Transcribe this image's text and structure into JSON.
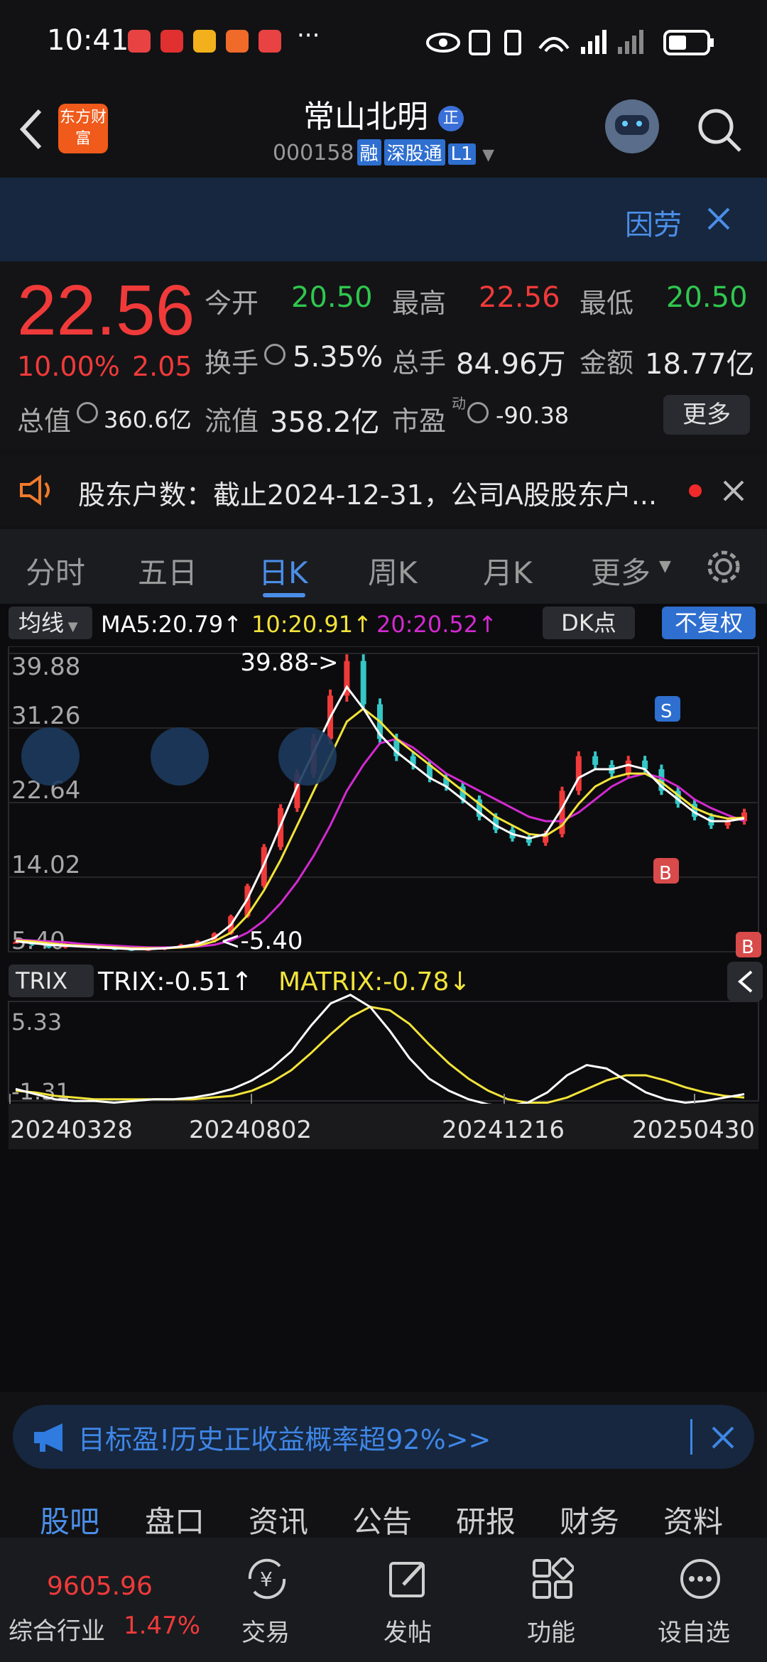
{
  "status": {
    "time": "10:41",
    "network": "5G"
  },
  "header": {
    "title": "常山北明",
    "title_badge": "正",
    "code": "000158",
    "tags": [
      "融",
      "深股通",
      "L1"
    ],
    "logo_text": "东方财富"
  },
  "banner": {
    "text": "因劳"
  },
  "quote": {
    "price": "22.56",
    "change_pct": "10.00%",
    "change_abs": "2.05",
    "open_label": "今开",
    "open": "20.50",
    "high_label": "最高",
    "high": "22.56",
    "low_label": "最低",
    "low": "20.50",
    "turnover_label": "换手",
    "turnover": "5.35%",
    "volume_label": "总手",
    "volume": "84.96万",
    "amount_label": "金额",
    "amount": "18.77亿",
    "mktcap_label": "总值",
    "mktcap": "360.6亿",
    "float_label": "流值",
    "float": "358.2亿",
    "pe_label": "市盈",
    "pe_sup": "动",
    "pe": "-90.38",
    "more": "更多"
  },
  "notice": {
    "text": "股东户数：截止2024-12-31，公司A股股东户..."
  },
  "tabs": [
    "分时",
    "五日",
    "日K",
    "周K",
    "月K",
    "更多"
  ],
  "active_tab": "日K",
  "chart_header": {
    "ma_btn": "均线",
    "ma5": "MA5:20.79↑",
    "ma10": "10:20.91↑",
    "ma20": "20:20.52↑",
    "dk": "DK点",
    "fq": "不复权"
  },
  "indicator_header": {
    "name": "TRIX",
    "trix": "TRIX:-0.51↑",
    "matrix": "MATRIX:-0.78↓"
  },
  "chart_data": {
    "type": "line",
    "y_ticks": [
      "39.88",
      "31.26",
      "22.64",
      "14.02",
      "5.40"
    ],
    "ylim": [
      5.4,
      39.88
    ],
    "max_label": "39.88->",
    "min_label": "<-5.40",
    "marks": [
      "S",
      "B",
      "B"
    ],
    "trix_ticks": [
      "5.33",
      "-1.31"
    ],
    "trix_ylim": [
      -1.31,
      5.33
    ],
    "x_ticks": [
      "20240328",
      "20240802",
      "20241216",
      "20250430"
    ],
    "colors": {
      "ma5": "#ffffff",
      "ma10": "#f2e33a",
      "ma20": "#d22ad0",
      "up": "#f03a3a",
      "down": "#35c6c6",
      "trix": "#ffffff",
      "matrix": "#f2e33a"
    },
    "price_close": [
      6.5,
      6.2,
      5.9,
      6.3,
      6.0,
      5.8,
      5.7,
      5.6,
      5.7,
      5.9,
      6.2,
      6.6,
      7.5,
      9.5,
      13.0,
      17.5,
      22.0,
      26.0,
      30.0,
      35.0,
      39.0,
      34.0,
      30.0,
      28.0,
      27.0,
      25.5,
      24.5,
      23.0,
      21.0,
      19.5,
      18.5,
      18.0,
      19.0,
      24.0,
      28.0,
      27.0,
      26.0,
      27.5,
      26.5,
      24.0,
      22.5,
      21.0,
      20.0,
      20.5,
      21.5
    ],
    "ma5": [
      6.6,
      6.4,
      6.2,
      6.1,
      6.0,
      5.9,
      5.8,
      5.7,
      5.7,
      5.8,
      6.0,
      6.3,
      7.0,
      8.5,
      11.5,
      15.5,
      20.0,
      24.5,
      28.5,
      32.5,
      36.0,
      33.5,
      30.5,
      28.5,
      27.0,
      25.5,
      24.5,
      23.0,
      21.5,
      20.0,
      19.0,
      18.5,
      19.0,
      22.0,
      25.5,
      26.5,
      26.5,
      27.0,
      26.5,
      24.5,
      23.0,
      21.5,
      20.5,
      20.5,
      20.8
    ],
    "ma10": [
      6.7,
      6.6,
      6.4,
      6.2,
      6.1,
      6.0,
      5.9,
      5.8,
      5.8,
      5.8,
      5.9,
      6.1,
      6.6,
      7.6,
      9.6,
      12.5,
      16.0,
      20.0,
      24.0,
      28.0,
      32.0,
      33.5,
      32.0,
      30.0,
      28.5,
      27.0,
      25.5,
      24.0,
      22.5,
      21.0,
      20.0,
      19.0,
      18.8,
      20.0,
      22.5,
      24.5,
      25.5,
      26.0,
      26.0,
      25.0,
      23.5,
      22.0,
      21.2,
      20.8,
      20.9
    ],
    "ma20": [
      6.8,
      6.7,
      6.6,
      6.5,
      6.3,
      6.2,
      6.1,
      6.0,
      5.9,
      5.9,
      5.9,
      6.0,
      6.2,
      6.7,
      7.6,
      9.0,
      11.0,
      13.5,
      16.5,
      20.0,
      24.0,
      27.0,
      29.5,
      30.0,
      29.0,
      27.5,
      26.0,
      25.0,
      24.0,
      23.0,
      22.0,
      21.0,
      20.5,
      20.5,
      21.5,
      23.0,
      24.5,
      25.5,
      26.0,
      25.5,
      24.5,
      23.0,
      22.0,
      21.2,
      20.5
    ],
    "trix": [
      -0.2,
      -0.5,
      -0.8,
      -0.9,
      -0.9,
      -1.0,
      -0.9,
      -0.8,
      -0.8,
      -0.7,
      -0.5,
      -0.2,
      0.3,
      1.0,
      2.0,
      3.5,
      4.8,
      5.3,
      4.6,
      3.2,
      1.6,
      0.4,
      -0.3,
      -0.8,
      -1.1,
      -1.2,
      -1.0,
      -0.4,
      0.6,
      1.2,
      1.0,
      0.3,
      -0.4,
      -0.8,
      -1.0,
      -0.9,
      -0.7,
      -0.5
    ],
    "matrix": [
      -0.3,
      -0.4,
      -0.6,
      -0.7,
      -0.8,
      -0.8,
      -0.8,
      -0.8,
      -0.8,
      -0.8,
      -0.7,
      -0.6,
      -0.3,
      0.2,
      0.9,
      1.9,
      3.0,
      4.0,
      4.6,
      4.4,
      3.6,
      2.4,
      1.3,
      0.4,
      -0.3,
      -0.8,
      -1.0,
      -1.0,
      -0.7,
      -0.2,
      0.3,
      0.6,
      0.6,
      0.3,
      -0.1,
      -0.4,
      -0.6,
      -0.7
    ]
  },
  "ad": {
    "text": "目标盈!历史正收益概率超92%>>"
  },
  "subnav": [
    "股吧",
    "盘口",
    "资讯",
    "公告",
    "研报",
    "财务",
    "资料"
  ],
  "bottom": {
    "index_value": "9605.96",
    "index_label": "综合行业",
    "index_pct": "1.47%",
    "items": [
      "交易",
      "发帖",
      "功能",
      "设自选"
    ]
  }
}
